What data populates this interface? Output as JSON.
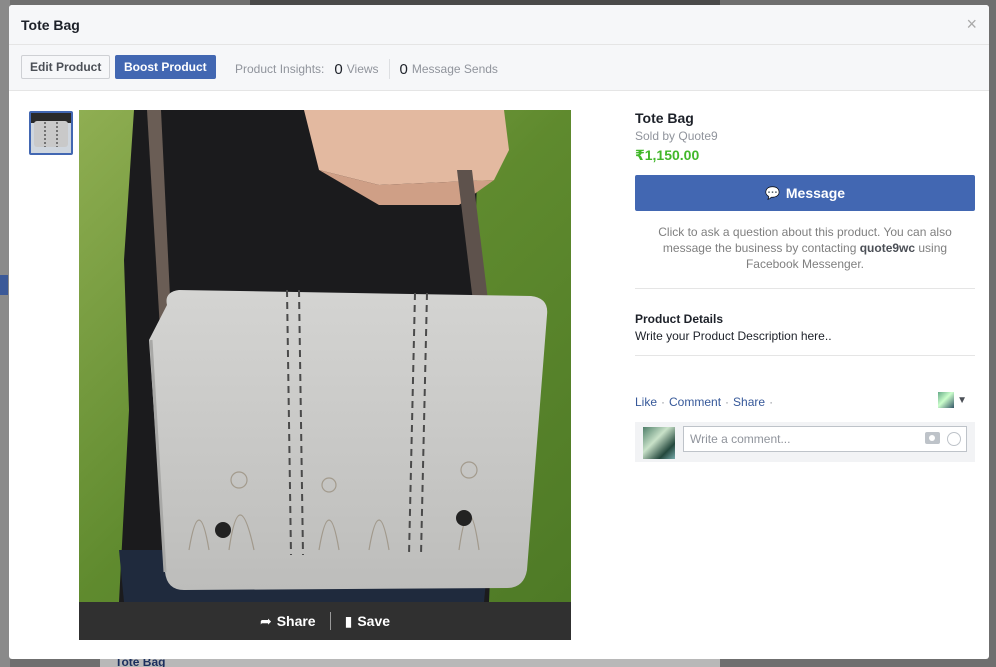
{
  "modal": {
    "title": "Tote Bag",
    "close_glyph": "×"
  },
  "toolbar": {
    "edit_label": "Edit Product",
    "boost_label": "Boost Product",
    "insights_label": "Product Insights:",
    "views_count": "0",
    "views_label": "Views",
    "sends_count": "0",
    "sends_label": "Message Sends"
  },
  "photo": {
    "share_label": "Share",
    "save_label": "Save",
    "share_icon": "share-arrow-icon",
    "save_icon": "bookmark-icon"
  },
  "product": {
    "name": "Tote Bag",
    "seller": "Sold by Quote9",
    "price": "₹1,150.00",
    "message_button": "Message",
    "help_text_1": "Click to ask a question about this product. You can also message the business by contacting ",
    "help_handle": "quote9wc",
    "help_text_2": " using Facebook Messenger.",
    "details_heading": "Product Details",
    "details_text": "Write your Product Description here.."
  },
  "social": {
    "like": "Like",
    "comment": "Comment",
    "share": "Share",
    "dot": "·",
    "comment_placeholder": "Write a comment..."
  },
  "background": {
    "bottom_link": "Tote Bag"
  },
  "colors": {
    "accent": "#4267b2",
    "price": "#42b72a",
    "link": "#365899"
  }
}
